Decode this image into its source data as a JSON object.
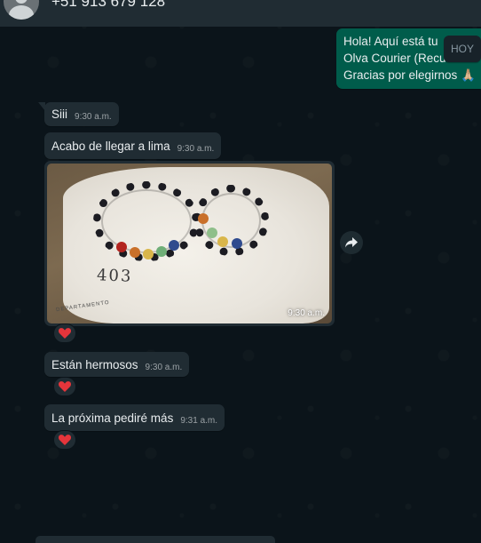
{
  "header": {
    "contact_name": "+51 913 679 128"
  },
  "date_badge": "HOY",
  "messages": {
    "outgoing_1": {
      "lines": [
        "Hola! Aquí está tu",
        "Olva Courier (Recu",
        "Gracias por elegirnos 🙏🏼"
      ]
    },
    "m1": {
      "text": "Siii",
      "time": "9:30 a.m."
    },
    "m2": {
      "text": "Acabo de llegar a lima",
      "time": "9:30 a.m."
    },
    "photo": {
      "time": "9:30 a.m.",
      "handwriting": "403",
      "stamp_text": "DEPARTAMENTO"
    },
    "m3": {
      "text": "Están hermosos",
      "time": "9:30 a.m."
    },
    "m4": {
      "text": "La próxima pediré más",
      "time": "9:31 a.m."
    }
  },
  "reactions": [
    "❤️",
    "❤️",
    "❤️"
  ],
  "icons": {
    "forward": "forward-icon",
    "avatar": "default-avatar-icon",
    "heart": "heart-icon"
  },
  "colors": {
    "chat_bg": "#0b141a",
    "incoming_bubble": "#202c33",
    "outgoing_bubble": "#005c4b",
    "heart": "#e5353b"
  }
}
